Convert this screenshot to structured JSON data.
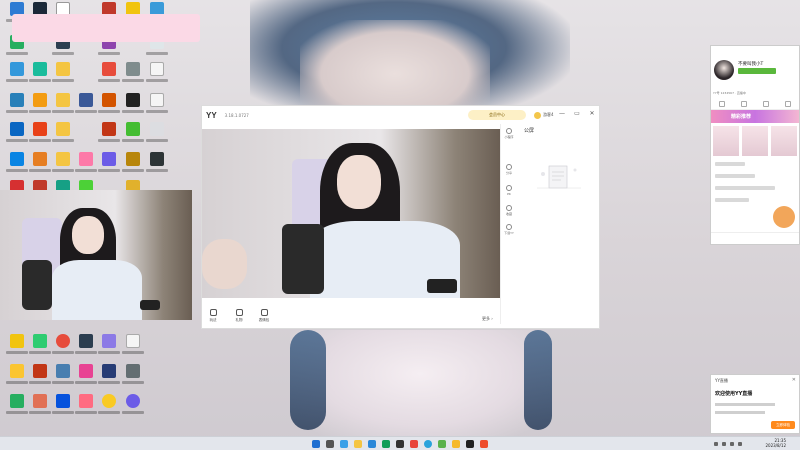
{
  "yy_window": {
    "logo": "YY",
    "version": "3.18.1.0727",
    "login_label": "会员中心",
    "username": "游客4",
    "min_icon": "—",
    "restore_icon": "▭",
    "close_icon": "✕",
    "side_items": [
      {
        "label": "小程序",
        "icon": "grid-icon"
      },
      {
        "label": "分享",
        "icon": "share-icon"
      },
      {
        "label": "PK",
        "icon": "pk-icon"
      },
      {
        "label": "收藏",
        "icon": "star-icon"
      },
      {
        "label": "下载YY",
        "icon": "download-icon"
      }
    ],
    "right_panel_title": "公屏",
    "bottom_items": [
      {
        "label": "玩法",
        "icon": "gamepad-icon"
      },
      {
        "label": "礼物",
        "icon": "gift-icon"
      },
      {
        "label": "表情包",
        "icon": "emoji-icon"
      }
    ],
    "more_label": "更多 ›"
  },
  "live_panel": {
    "streamer_name": "不要叫我小T",
    "info": "YY号 1234567 · 直播中",
    "banner_text": "精彩推荐",
    "colors": {
      "accent": "#5ab83c",
      "banner": "#c874e0"
    }
  },
  "notification": {
    "header": "YY直播",
    "title": "欢迎使用YY直播",
    "button": "立即体验",
    "close_icon": "✕"
  },
  "taskbar": {
    "time": "21:35",
    "date": "2023/8/12"
  }
}
